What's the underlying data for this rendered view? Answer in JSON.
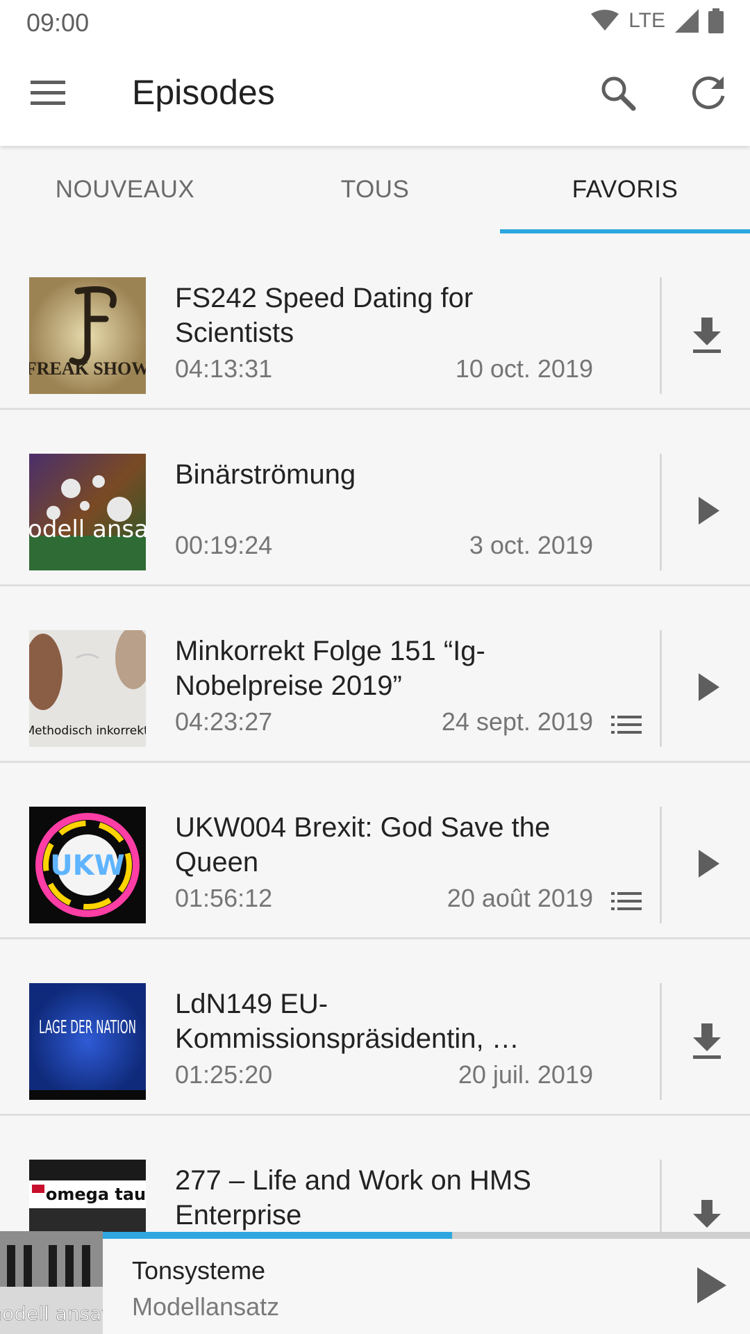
{
  "status_bar": {
    "time": "09:00",
    "network": "LTE"
  },
  "app_bar": {
    "title": "Episodes"
  },
  "tabs": [
    {
      "label": "NOUVEAUX",
      "active": false
    },
    {
      "label": "TOUS",
      "active": false
    },
    {
      "label": "FAVORIS",
      "active": true
    }
  ],
  "episodes": [
    {
      "title": "FS242 Speed Dating for Scientists",
      "duration": "04:13:31",
      "date": "10 oct. 2019",
      "action": "download-icon",
      "queued": false,
      "cover_text": "FREAK SHOW"
    },
    {
      "title": "Binärströmung",
      "duration": "00:19:24",
      "date": "3 oct. 2019",
      "action": "play-icon",
      "queued": false,
      "cover_text": "modell ansatz"
    },
    {
      "title": "Minkorrekt Folge 151 “Ig-Nobelpreise 2019”",
      "duration": "04:23:27",
      "date": "24 sept. 2019",
      "action": "play-icon",
      "queued": true,
      "cover_text": "Methodisch inkorrekt!"
    },
    {
      "title": "UKW004 Brexit: God Save the Queen",
      "duration": "01:56:12",
      "date": "20 août 2019",
      "action": "play-icon",
      "queued": true,
      "cover_text": "UKW"
    },
    {
      "title": "LdN149 EU-Kommissionspräsidentin, …",
      "duration": "01:25:20",
      "date": "20 juil. 2019",
      "action": "download-icon",
      "queued": false,
      "cover_text": "LAGE DER NATION"
    },
    {
      "title": "277 – Life and Work on HMS Enterprise",
      "duration": "",
      "date": "",
      "action": "download-icon",
      "queued": false,
      "cover_text": "omega tau"
    }
  ],
  "player": {
    "title": "Tonsysteme",
    "podcast": "Modellansatz",
    "progress": 0.54,
    "cover_text": "modell ansatz"
  },
  "colors": {
    "accent": "#2ea6df",
    "background": "#f6f6f6",
    "text_secondary": "#757575"
  }
}
